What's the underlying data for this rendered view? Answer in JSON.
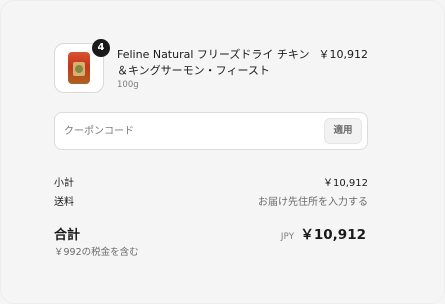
{
  "product": {
    "quantity_badge": "4",
    "name": "Feline Natural フリーズドライ チキン＆キングサーモン・フィースト",
    "variant": "100g",
    "price": "￥10,912",
    "image_icon": "cat-food-bag-icon"
  },
  "coupon": {
    "placeholder": "クーポンコード",
    "value": "",
    "apply_label": "適用"
  },
  "summary": {
    "subtotal_label": "小計",
    "subtotal_value": "￥10,912",
    "shipping_label": "送料",
    "shipping_value": "お届け先住所を入力する",
    "total_label": "合計",
    "currency": "JPY",
    "total_value": "￥10,912",
    "tax_note": "￥992の税金を含む"
  }
}
